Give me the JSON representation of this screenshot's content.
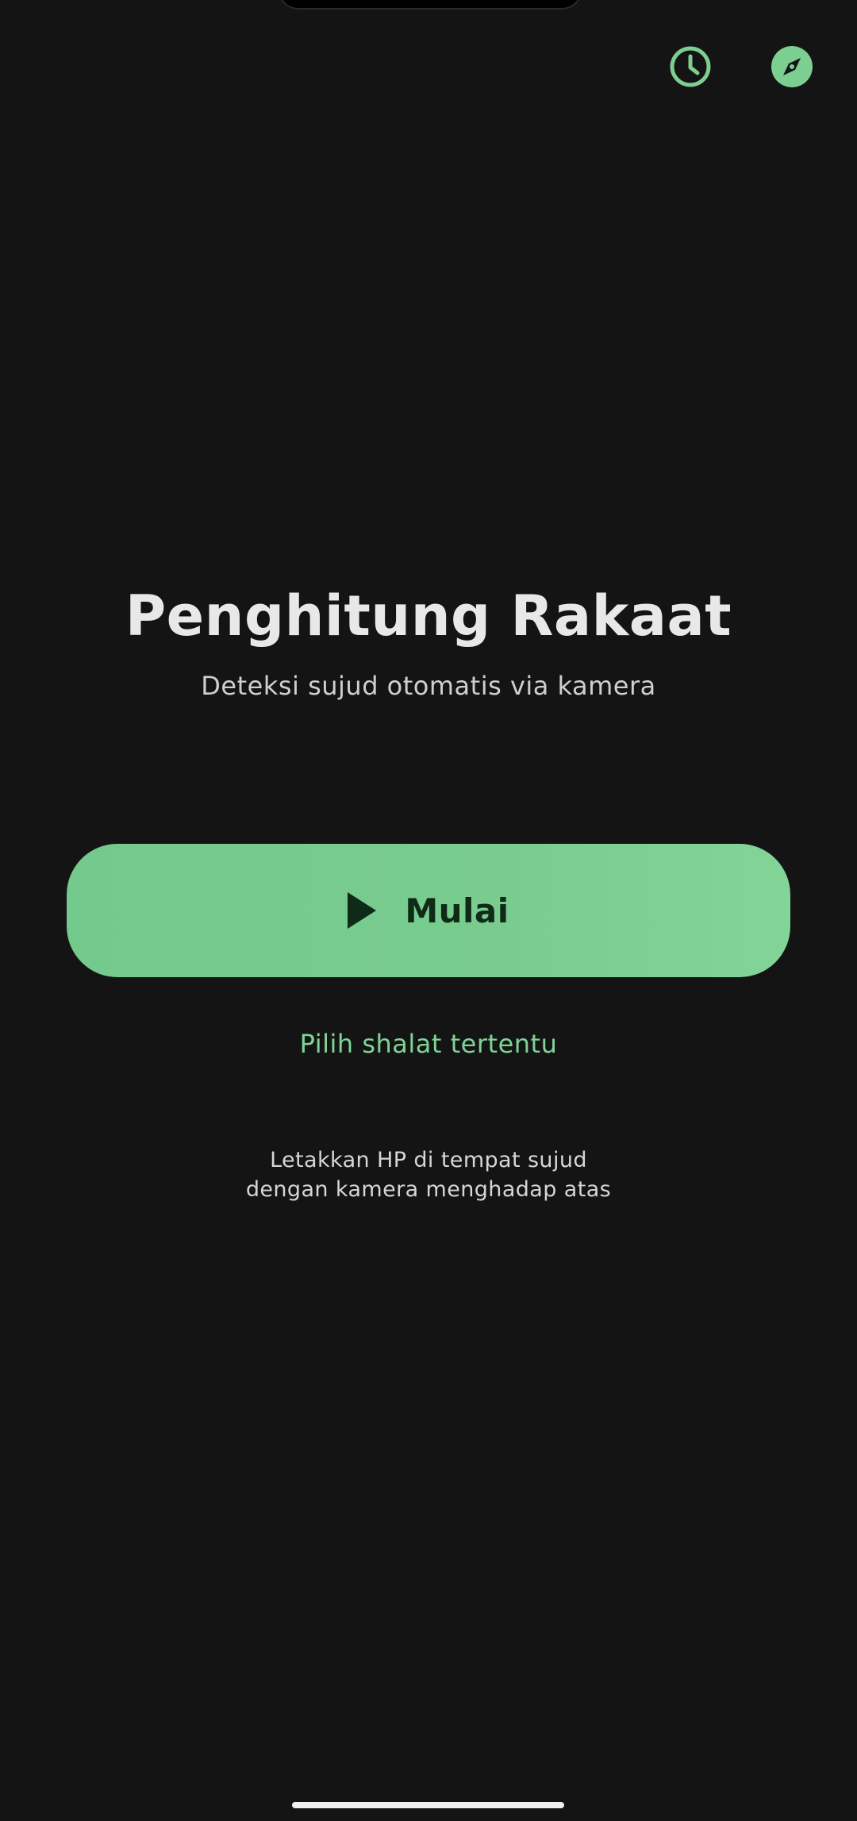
{
  "header": {
    "history_icon": "clock-icon",
    "qibla_icon": "compass-icon"
  },
  "hero": {
    "title": "Penghitung Rakaat",
    "subtitle": "Deteksi sujud otomatis via kamera"
  },
  "start_button": {
    "icon": "play-icon",
    "label": "Mulai"
  },
  "pick_prayer_link": "Pilih shalat tertentu",
  "hint": {
    "line1": "Letakkan HP di tempat sujud",
    "line2": "dengan kamera menghadap atas"
  },
  "colors": {
    "background": "#141414",
    "accent": "#7ccf91",
    "accent_text": "#0f2a17"
  }
}
